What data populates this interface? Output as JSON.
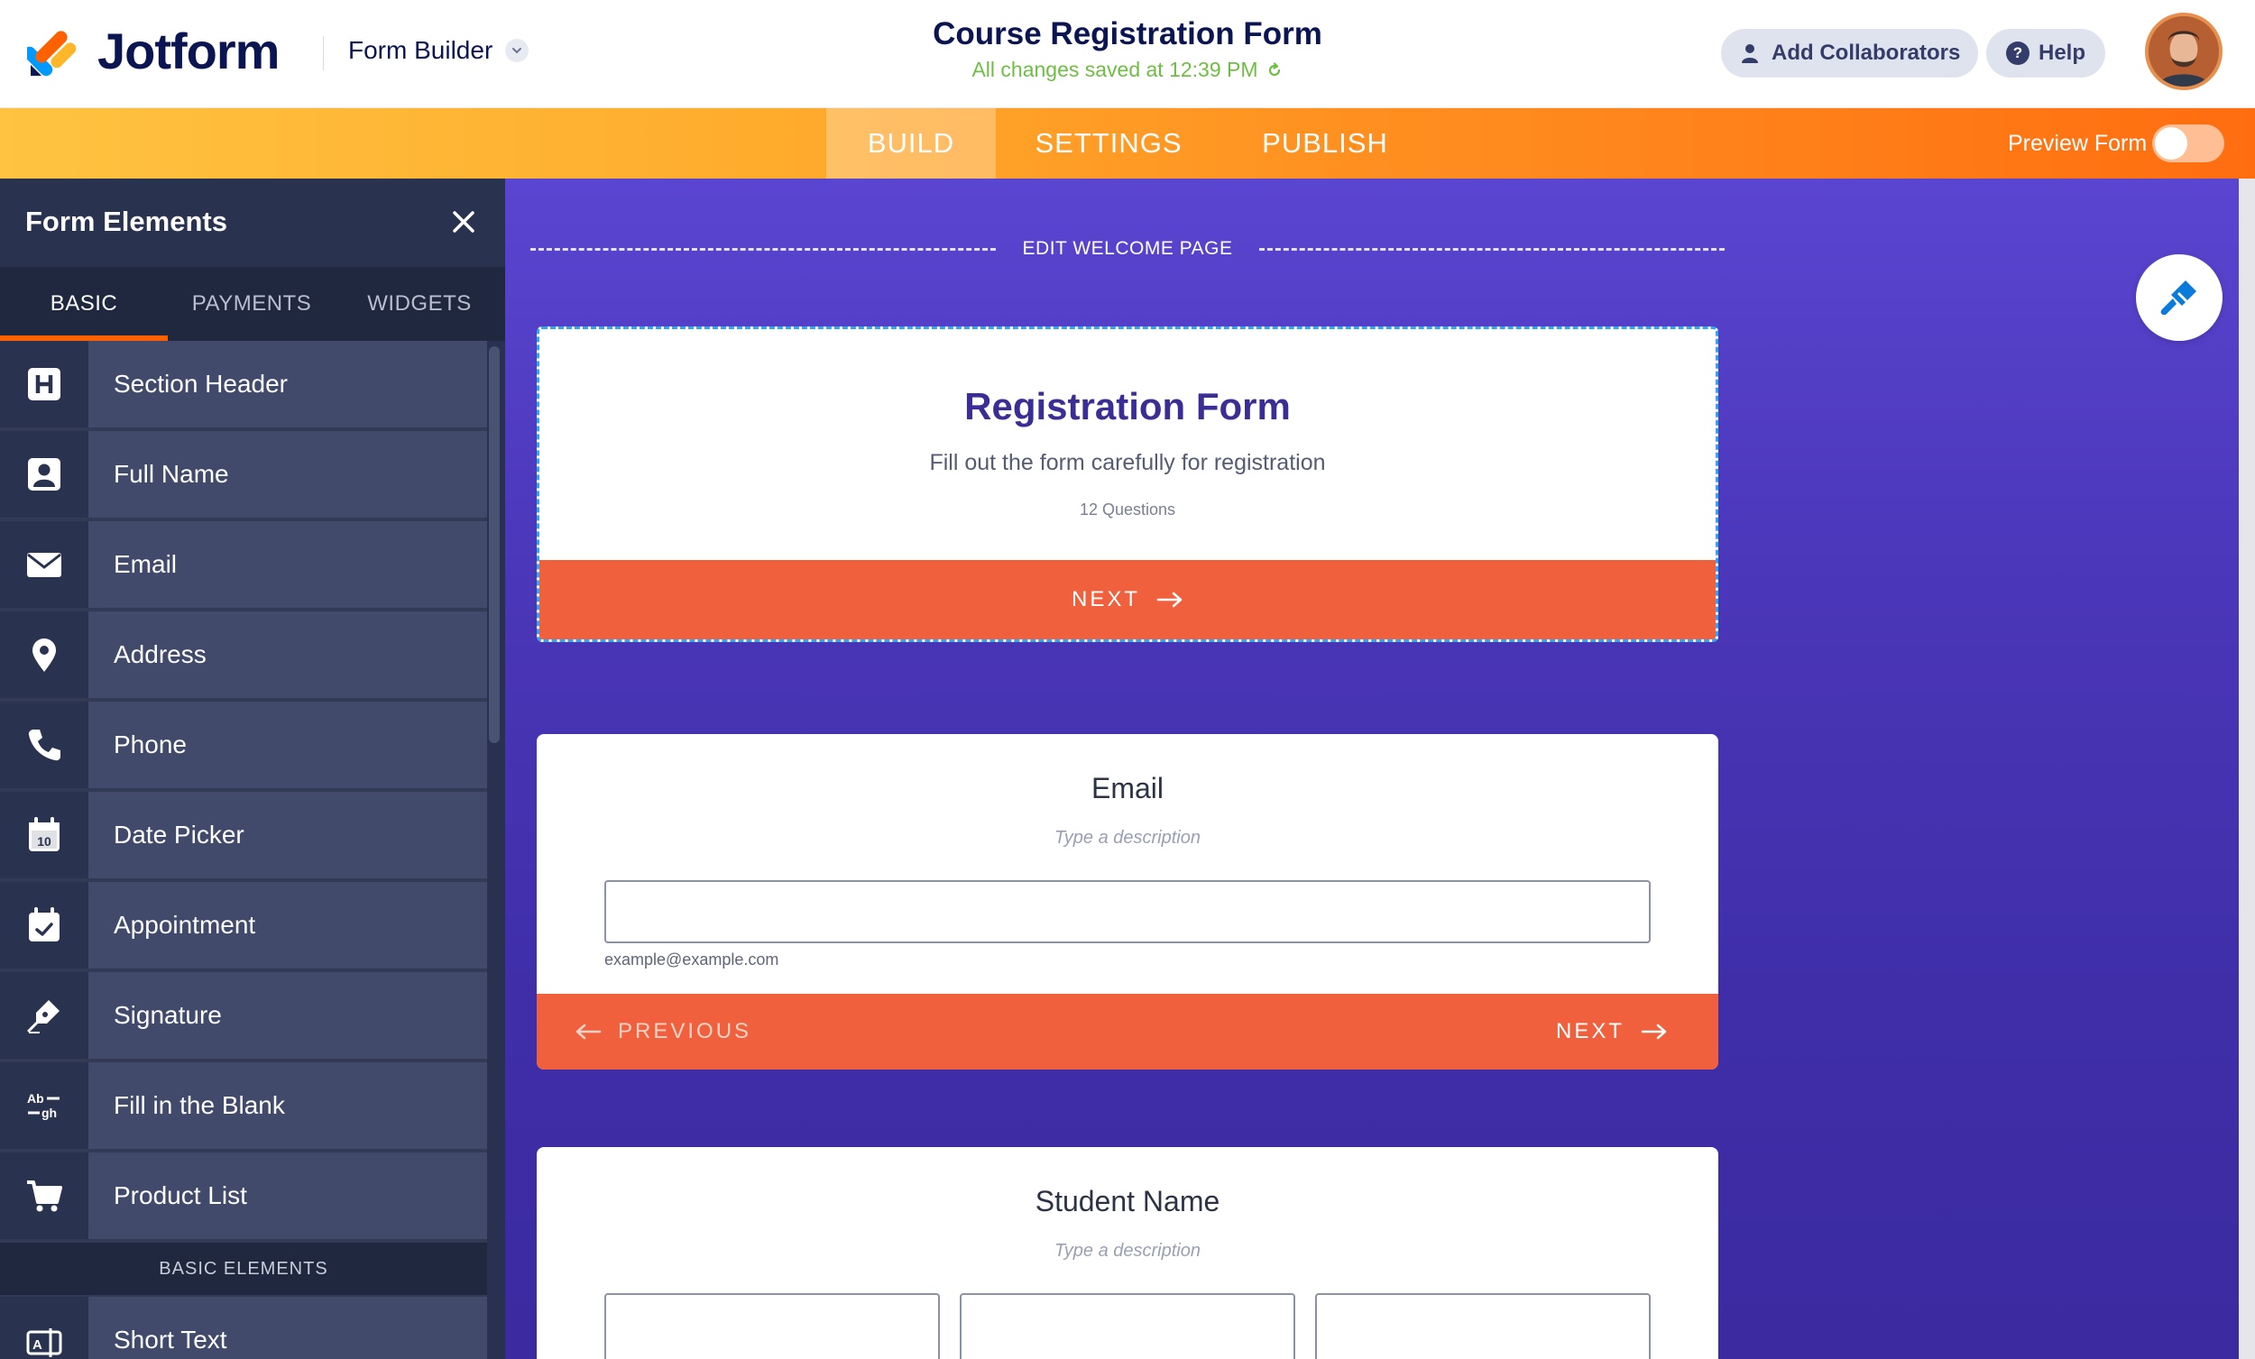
{
  "header": {
    "brand": "Jotform",
    "builder_label": "Form Builder",
    "form_title": "Course Registration Form",
    "save_status": "All changes saved at 12:39 PM",
    "add_collaborators": "Add Collaborators",
    "help": "Help"
  },
  "nav": {
    "tabs": [
      {
        "label": "BUILD",
        "active": true
      },
      {
        "label": "SETTINGS",
        "active": false
      },
      {
        "label": "PUBLISH",
        "active": false
      }
    ],
    "preview_label": "Preview Form",
    "preview_on": false
  },
  "sidebar": {
    "title": "Form Elements",
    "tabs": [
      {
        "label": "BASIC",
        "active": true
      },
      {
        "label": "PAYMENTS",
        "active": false
      },
      {
        "label": "WIDGETS",
        "active": false
      }
    ],
    "items": [
      {
        "label": "Section Header",
        "icon": "heading-icon"
      },
      {
        "label": "Full Name",
        "icon": "person-icon"
      },
      {
        "label": "Email",
        "icon": "envelope-icon"
      },
      {
        "label": "Address",
        "icon": "map-pin-icon"
      },
      {
        "label": "Phone",
        "icon": "phone-icon"
      },
      {
        "label": "Date Picker",
        "icon": "calendar-icon"
      },
      {
        "label": "Appointment",
        "icon": "calendar-check-icon"
      },
      {
        "label": "Signature",
        "icon": "pen-nib-icon"
      },
      {
        "label": "Fill in the Blank",
        "icon": "fill-blank-icon"
      },
      {
        "label": "Product List",
        "icon": "cart-icon"
      }
    ],
    "section_label": "BASIC ELEMENTS",
    "items_after": [
      {
        "label": "Short Text",
        "icon": "text-field-icon"
      }
    ]
  },
  "canvas": {
    "edit_welcome": "EDIT WELCOME PAGE",
    "welcome": {
      "title": "Registration Form",
      "subtitle": "Fill out the form carefully for registration",
      "questions": "12  Questions",
      "next": "NEXT"
    },
    "email_question": {
      "title": "Email",
      "description_placeholder": "Type a description",
      "sublabel": "example@example.com",
      "previous": "PREVIOUS",
      "next": "NEXT"
    },
    "name_question": {
      "title": "Student Name",
      "description_placeholder": "Type a description"
    }
  },
  "colors": {
    "brand_navy": "#0a1551",
    "save_green": "#6fbe44",
    "nav_orange": "#ff7b17",
    "accent_orange": "#ff6100",
    "button_orange": "#f0603c",
    "canvas_purple": "#4a36b8",
    "title_purple": "#3a2d95"
  }
}
